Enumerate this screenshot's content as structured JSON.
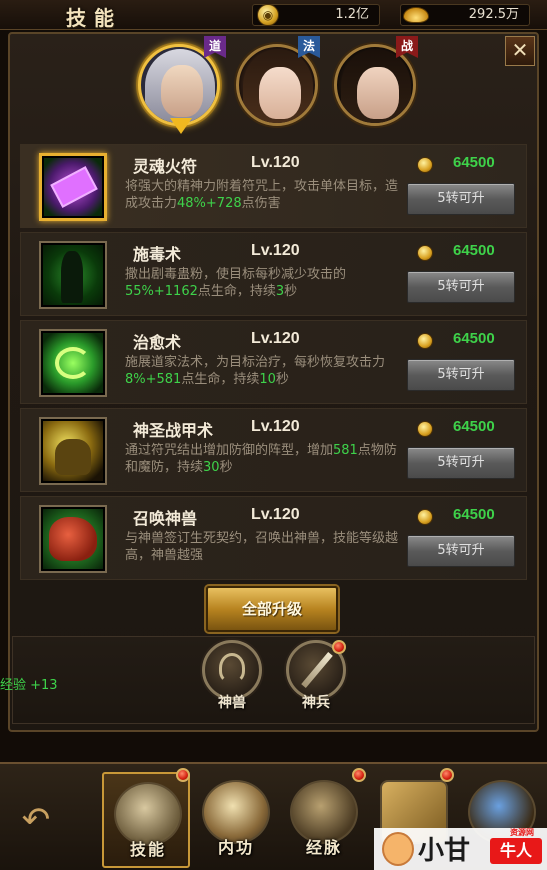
{
  "header": {
    "title": "技能",
    "gold": "1.2亿",
    "ingot": "292.5万"
  },
  "close_glyph": "✕",
  "classes": [
    {
      "tag": "道",
      "tag_color": "#6a2a8a"
    },
    {
      "tag": "法",
      "tag_color": "#2a5a9a"
    },
    {
      "tag": "战",
      "tag_color": "#8a1a1a"
    }
  ],
  "skills": [
    {
      "name": "灵魂火符",
      "level": "Lv.120",
      "cost": "64500",
      "button": "5转可升",
      "desc_pre": "将强大的精神力附着符咒上，攻击单体目标，造成攻击力",
      "desc_hl1": "48%+728",
      "desc_mid": "点伤害",
      "desc_hl2": "",
      "desc_post": ""
    },
    {
      "name": "施毒术",
      "level": "Lv.120",
      "cost": "64500",
      "button": "5转可升",
      "desc_pre": "撒出剧毒蛊粉，使目标每秒减少攻击的",
      "desc_hl1": "55%+1162",
      "desc_mid": "点生命，持续",
      "desc_hl2": "3",
      "desc_post": "秒"
    },
    {
      "name": "治愈术",
      "level": "Lv.120",
      "cost": "64500",
      "button": "5转可升",
      "desc_pre": "施展道家法术，为目标治疗，每秒恢复攻击力",
      "desc_hl1": "8%+581",
      "desc_mid": "点生命，持续",
      "desc_hl2": "10",
      "desc_post": "秒"
    },
    {
      "name": "神圣战甲术",
      "level": "Lv.120",
      "cost": "64500",
      "button": "5转可升",
      "desc_pre": "通过符咒结出增加防御的阵型，增加",
      "desc_hl1": "581",
      "desc_mid": "点物防和魔防，持续",
      "desc_hl2": "30",
      "desc_post": "秒"
    },
    {
      "name": "召唤神兽",
      "level": "Lv.120",
      "cost": "64500",
      "button": "5转可升",
      "desc_pre": "与神兽签订生死契约，召唤出神兽，技能等级越高，神兽越强",
      "desc_hl1": "",
      "desc_mid": "",
      "desc_hl2": "",
      "desc_post": ""
    }
  ],
  "upgrade_all": "全部升级",
  "round_buttons": {
    "beast": "神兽",
    "weapon": "神兵"
  },
  "exp_text": "经验 +13",
  "tabs": {
    "skill": "技能",
    "inner": "内功",
    "meridian": "经脉"
  },
  "watermark": {
    "brand": "小甘",
    "badge": "牛人",
    "site": "资源网"
  }
}
